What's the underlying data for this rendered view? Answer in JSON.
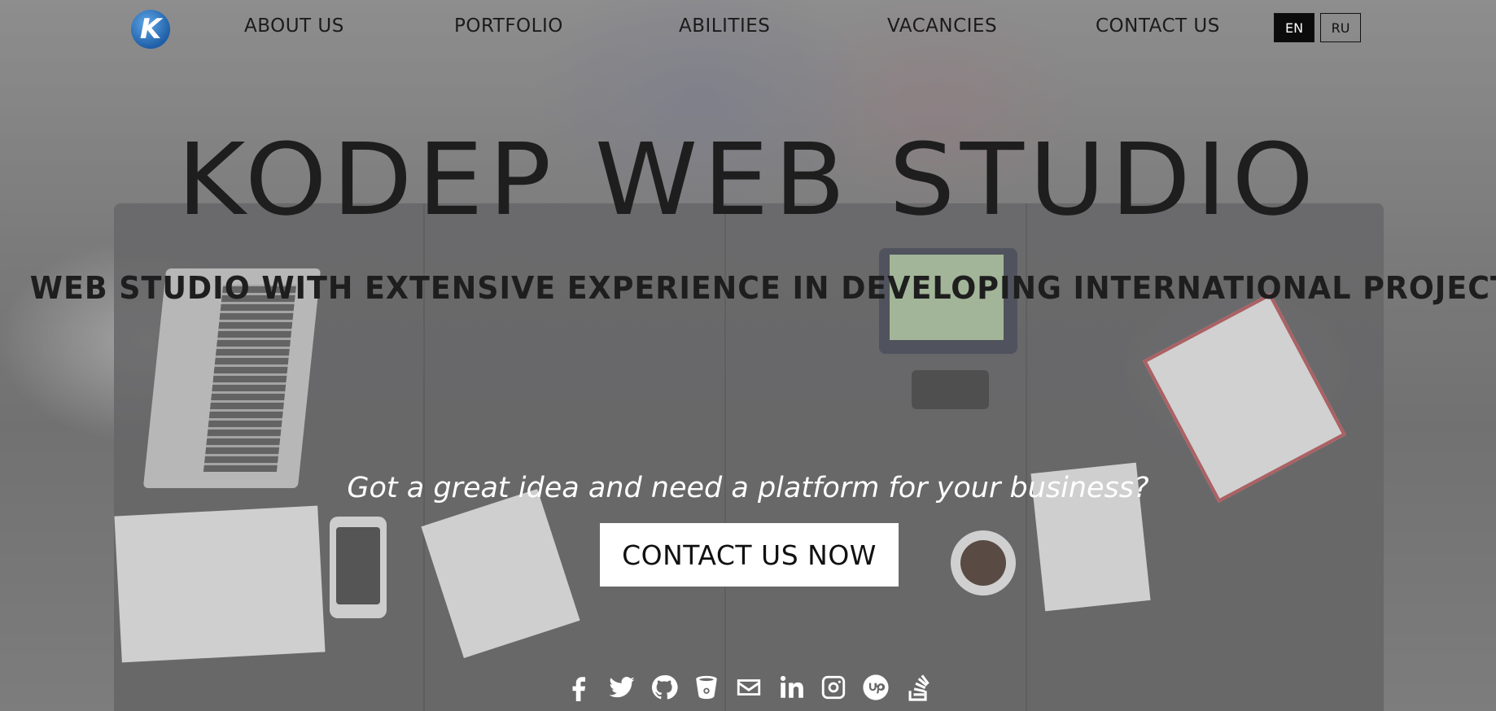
{
  "header": {
    "logo_letter": "K",
    "nav": [
      {
        "label": "ABOUT US"
      },
      {
        "label": "PORTFOLIO"
      },
      {
        "label": "ABILITIES"
      },
      {
        "label": "VACANCIES"
      },
      {
        "label": "CONTACT US"
      }
    ],
    "languages": [
      {
        "label": "EN",
        "active": true
      },
      {
        "label": "RU",
        "active": false
      }
    ]
  },
  "hero": {
    "title": "KODEP WEB STUDIO",
    "subtitle": "WEB STUDIO WITH EXTENSIVE EXPERIENCE IN DEVELOPING INTERNATIONAL PROJECTS",
    "tagline": "Got a great idea and need a platform for your business?",
    "cta_label": "CONTACT US NOW"
  },
  "social": [
    {
      "icon": "facebook-icon"
    },
    {
      "icon": "twitter-icon"
    },
    {
      "icon": "github-icon"
    },
    {
      "icon": "bitbucket-icon"
    },
    {
      "icon": "email-icon"
    },
    {
      "icon": "linkedin-icon"
    },
    {
      "icon": "instagram-icon"
    },
    {
      "icon": "upwork-icon"
    },
    {
      "icon": "stackoverflow-icon"
    }
  ],
  "colors": {
    "text_dark": "#1e1e1e",
    "tagline": "#ffffff",
    "lang_active_bg": "#0b0b0b",
    "cta_bg": "#ffffff"
  }
}
